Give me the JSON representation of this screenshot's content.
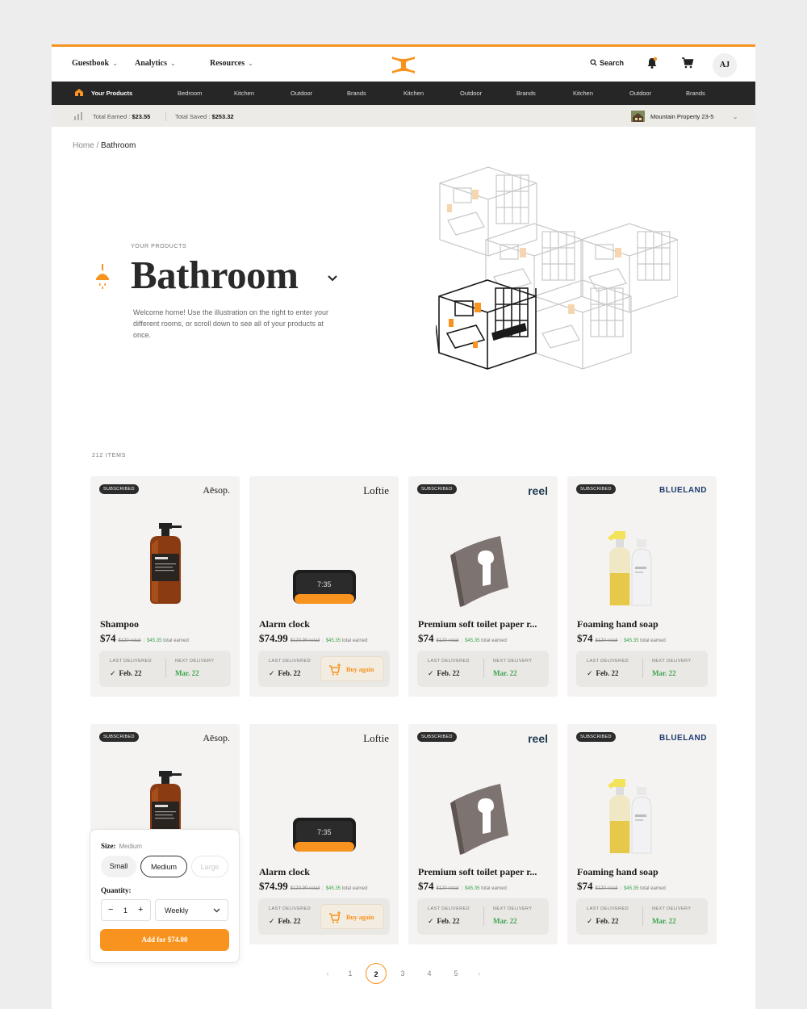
{
  "header": {
    "nav": [
      "Guestbook",
      "Analytics",
      "Resources"
    ],
    "search_label": "Search",
    "avatar_initials": "AJ"
  },
  "category_nav": [
    "Your Products",
    "Bedroom",
    "Kitchen",
    "Outdoor",
    "Brands",
    "Kitchen",
    "Outdoor",
    "Brands",
    "Kitchen",
    "Outdoor",
    "Brands"
  ],
  "stats": {
    "earned_label": "Total Earned :",
    "earned_value": "$23.55",
    "saved_label": "Total Saved :",
    "saved_value": "$253.32",
    "property": "Mountain Property 23-5"
  },
  "breadcrumb": {
    "home": "Home",
    "sep": "/",
    "current": "Bathroom"
  },
  "hero": {
    "eyebrow": "YOUR PRODUCTS",
    "title": "Bathroom",
    "description": "Welcome home! Use the illustration on the right to enter your different rooms, or scroll down to see all of your products at once."
  },
  "items_count": "212 ITEMS",
  "colors": {
    "accent": "#f7931e",
    "earned_green": "#3aa34a",
    "dark_nav": "#262626"
  },
  "products": [
    {
      "badge": "SUBSCRIBED",
      "brand": "Aēsop.",
      "name": "Shampoo",
      "price": "$74",
      "retail": "$120 retail",
      "earned": "$45.35",
      "earned_suffix": "total earned",
      "last_label": "LAST DELIVERED",
      "last": "Feb. 22",
      "next_label": "NEXT DELIVERY",
      "next": "Mar. 22",
      "buy_again": ""
    },
    {
      "badge": "",
      "brand": "Loftie",
      "name": "Alarm clock",
      "price": "$74.99",
      "retail": "$120.99 retail",
      "earned": "$45.35",
      "earned_suffix": "total earned",
      "last_label": "LAST DELIVERED",
      "last": "Feb. 22",
      "next_label": "",
      "next": "",
      "buy_again": "Buy again",
      "clock": "7:35"
    },
    {
      "badge": "SUBSCRIBED",
      "brand": "reel",
      "name": "Premium soft toilet paper r...",
      "price": "$74",
      "retail": "$120 retail",
      "earned": "$45.35",
      "earned_suffix": "total earned",
      "last_label": "LAST DELIVERED",
      "last": "Feb. 22",
      "next_label": "NEXT DELIVERY",
      "next": "Mar. 22",
      "buy_again": ""
    },
    {
      "badge": "SUBSCRIBED",
      "brand": "BLUELAND",
      "name": "Foaming hand soap",
      "price": "$74",
      "retail": "$120 retail",
      "earned": "$45.35",
      "earned_suffix": "total earned",
      "last_label": "LAST DELIVERED",
      "last": "Feb. 22",
      "next_label": "NEXT DELIVERY",
      "next": "Mar. 22",
      "buy_again": ""
    }
  ],
  "popover": {
    "size_label": "Size:",
    "size_value": "Medium",
    "sizes": [
      "Small",
      "Medium",
      "Large"
    ],
    "quantity_label": "Quantity:",
    "quantity_value": "1",
    "minus": "−",
    "plus": "+",
    "frequency": "Weekly",
    "add_button": "Add for $74.00"
  },
  "pagination": {
    "pages": [
      "1",
      "2",
      "3",
      "4",
      "5"
    ],
    "current": "2"
  }
}
